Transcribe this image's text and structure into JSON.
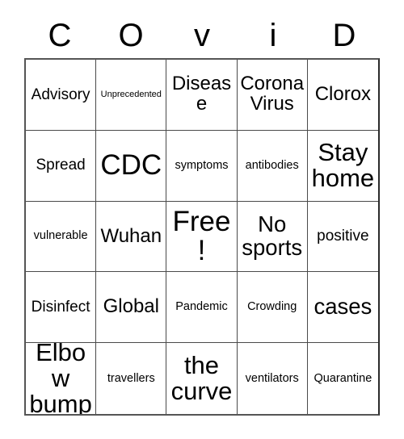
{
  "card": {
    "title_letters": [
      "C",
      "O",
      "v",
      "i",
      "D"
    ],
    "columns": 5,
    "rows": 5,
    "free_space_index": 12,
    "colors": {
      "background": "#ffffff",
      "text": "#000000",
      "grid_line": "#4a4a4a",
      "outer_border": "#555555"
    },
    "cells": [
      {
        "text": "Advisory",
        "size": "sz-m"
      },
      {
        "text": "Unprecedented",
        "size": "sz-xs"
      },
      {
        "text": "Disease",
        "size": "sz-l"
      },
      {
        "text": "Corona\nVirus",
        "size": "sz-l"
      },
      {
        "text": "Clorox",
        "size": "sz-l"
      },
      {
        "text": "Spread",
        "size": "sz-m"
      },
      {
        "text": "CDC",
        "size": "sz-huge"
      },
      {
        "text": "symptoms",
        "size": "sz-s"
      },
      {
        "text": "antibodies",
        "size": "sz-s"
      },
      {
        "text": "Stay\nhome",
        "size": "sz-xxl"
      },
      {
        "text": "vulnerable",
        "size": "sz-s"
      },
      {
        "text": "Wuhan",
        "size": "sz-l"
      },
      {
        "text": "Free!",
        "size": "sz-huge"
      },
      {
        "text": "No\nsports",
        "size": "sz-xl"
      },
      {
        "text": "positive",
        "size": "sz-m"
      },
      {
        "text": "Disinfect",
        "size": "sz-m"
      },
      {
        "text": "Global",
        "size": "sz-l"
      },
      {
        "text": "Pandemic",
        "size": "sz-s"
      },
      {
        "text": "Crowding",
        "size": "sz-s"
      },
      {
        "text": "cases",
        "size": "sz-xl"
      },
      {
        "text": "Elbow\nbump",
        "size": "sz-xxl"
      },
      {
        "text": "travellers",
        "size": "sz-s"
      },
      {
        "text": "the\ncurve",
        "size": "sz-xxl"
      },
      {
        "text": "ventilators",
        "size": "sz-s"
      },
      {
        "text": "Quarantine",
        "size": "sz-s"
      }
    ]
  }
}
